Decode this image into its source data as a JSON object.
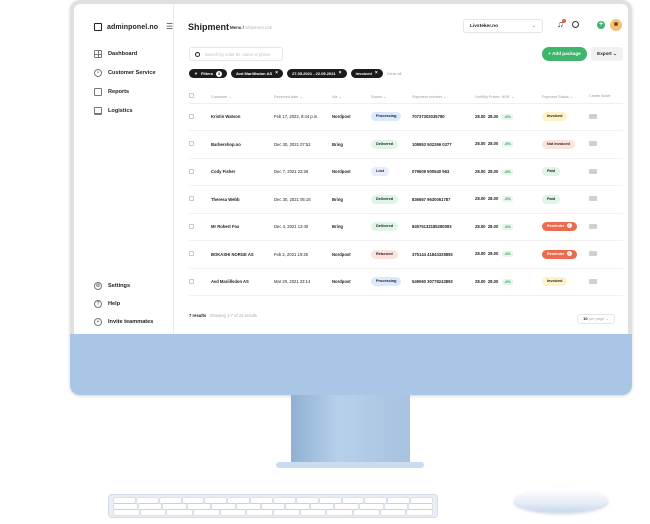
{
  "app": {
    "name": "adminponel.no"
  },
  "sidebar": {
    "items": [
      {
        "label": "Dashboard",
        "icon": "grid-icon"
      },
      {
        "label": "Customer Service",
        "icon": "lifebuoy-icon"
      },
      {
        "label": "Reports",
        "icon": "chart-icon"
      },
      {
        "label": "Logistics",
        "icon": "truck-icon"
      }
    ],
    "bottom_items": [
      {
        "label": "Settings",
        "icon": "gear-icon"
      },
      {
        "label": "Help",
        "icon": "help-icon"
      },
      {
        "label": "Invite teammates",
        "icon": "invite-icon"
      }
    ]
  },
  "header": {
    "title": "Shipment",
    "breadcrumb_parent": "Menu /",
    "breadcrumb_current": "Shipment List",
    "account": "Livsteker.no"
  },
  "search": {
    "placeholder": "Search by order ID, name or phone"
  },
  "actions": {
    "add_package": "+ Add package",
    "export": "Export"
  },
  "filters": {
    "filters_label": "Filters",
    "filters_count": "3",
    "chips": [
      "Avd Mariillsdon AS",
      "27.05.2021 - 22.05.2021",
      "Invoiced"
    ],
    "clear_all": "Clear all"
  },
  "table": {
    "columns": [
      "Customer",
      "Received date",
      "Via",
      "Status",
      "Shipment number",
      "Unit/My Prices, NOK",
      "Payment Status",
      "Create ticket"
    ],
    "rows": [
      {
        "customer": "Kristin Watson",
        "date": "Feb 17, 2022, 9:44 p.m.",
        "via": "Nordpost",
        "status": "Processing",
        "number": "70737303035780",
        "price": "28.00",
        "my_price": "28.00",
        "pct": "-6%",
        "payment": "Invoiced",
        "warn": false
      },
      {
        "customer": "Barbershop.no",
        "date": "Dec 30, 2021 07:52",
        "via": "Bring",
        "status": "Delivered",
        "number": "108953 502269 0377",
        "price": "28.00",
        "my_price": "28.00",
        "pct": "-6%",
        "payment": "Not invoiced",
        "warn": false
      },
      {
        "customer": "Cody Fisher",
        "date": "Dec 7, 2021 23:26",
        "via": "Nordpost",
        "status": "Lost",
        "number": "079609 500540 963",
        "price": "28.00",
        "my_price": "28.00",
        "pct": "-6%",
        "payment": "Paid",
        "warn": false
      },
      {
        "customer": "Theresa Webb",
        "date": "Dec 30, 2021 05:18",
        "via": "Bring",
        "status": "Delivered",
        "number": "836657 9630061787",
        "price": "28.00",
        "my_price": "28.00",
        "pct": "-6%",
        "payment": "Paid",
        "warn": false
      },
      {
        "customer": "Mr Robert Fox",
        "date": "Dec 4, 2021 13:40",
        "via": "Bring",
        "status": "Delivered",
        "number": "84575133185280093",
        "price": "28.00",
        "my_price": "28.00",
        "pct": "-6%",
        "payment": "Reminder",
        "warn": true
      },
      {
        "customer": "BOKASHI NORGE AS",
        "date": "Feb 2, 2021 19:28",
        "via": "Nordpost",
        "status": "Returned",
        "number": "375144 41843329893",
        "price": "28.00",
        "my_price": "28.00",
        "pct": "-6%",
        "payment": "Reminder",
        "warn": true
      },
      {
        "customer": "Avd Mariillsdon AS",
        "date": "Mar 20, 2021 23:14",
        "via": "Nordpost",
        "status": "Processing",
        "number": "549060 30778243893",
        "price": "28.00",
        "my_price": "28.00",
        "pct": "-6%",
        "payment": "Invoiced",
        "warn": false
      }
    ]
  },
  "footer": {
    "results": "7 results",
    "showing": "Showing 1-7 of 23 results",
    "per_page_value": "10",
    "per_page_label": "per page"
  },
  "colors": {
    "accent_green": "#3fb56c",
    "status_processing": "#dbe9ff",
    "status_delivered": "#dff5e7",
    "status_lost": "#e7ecff",
    "status_returned": "#fde3dd",
    "pay_invoiced": "#fff2c8",
    "pay_not_invoiced": "#fde3dd",
    "pay_paid": "#dff5e7",
    "pay_reminder": "#ec6b4f"
  }
}
